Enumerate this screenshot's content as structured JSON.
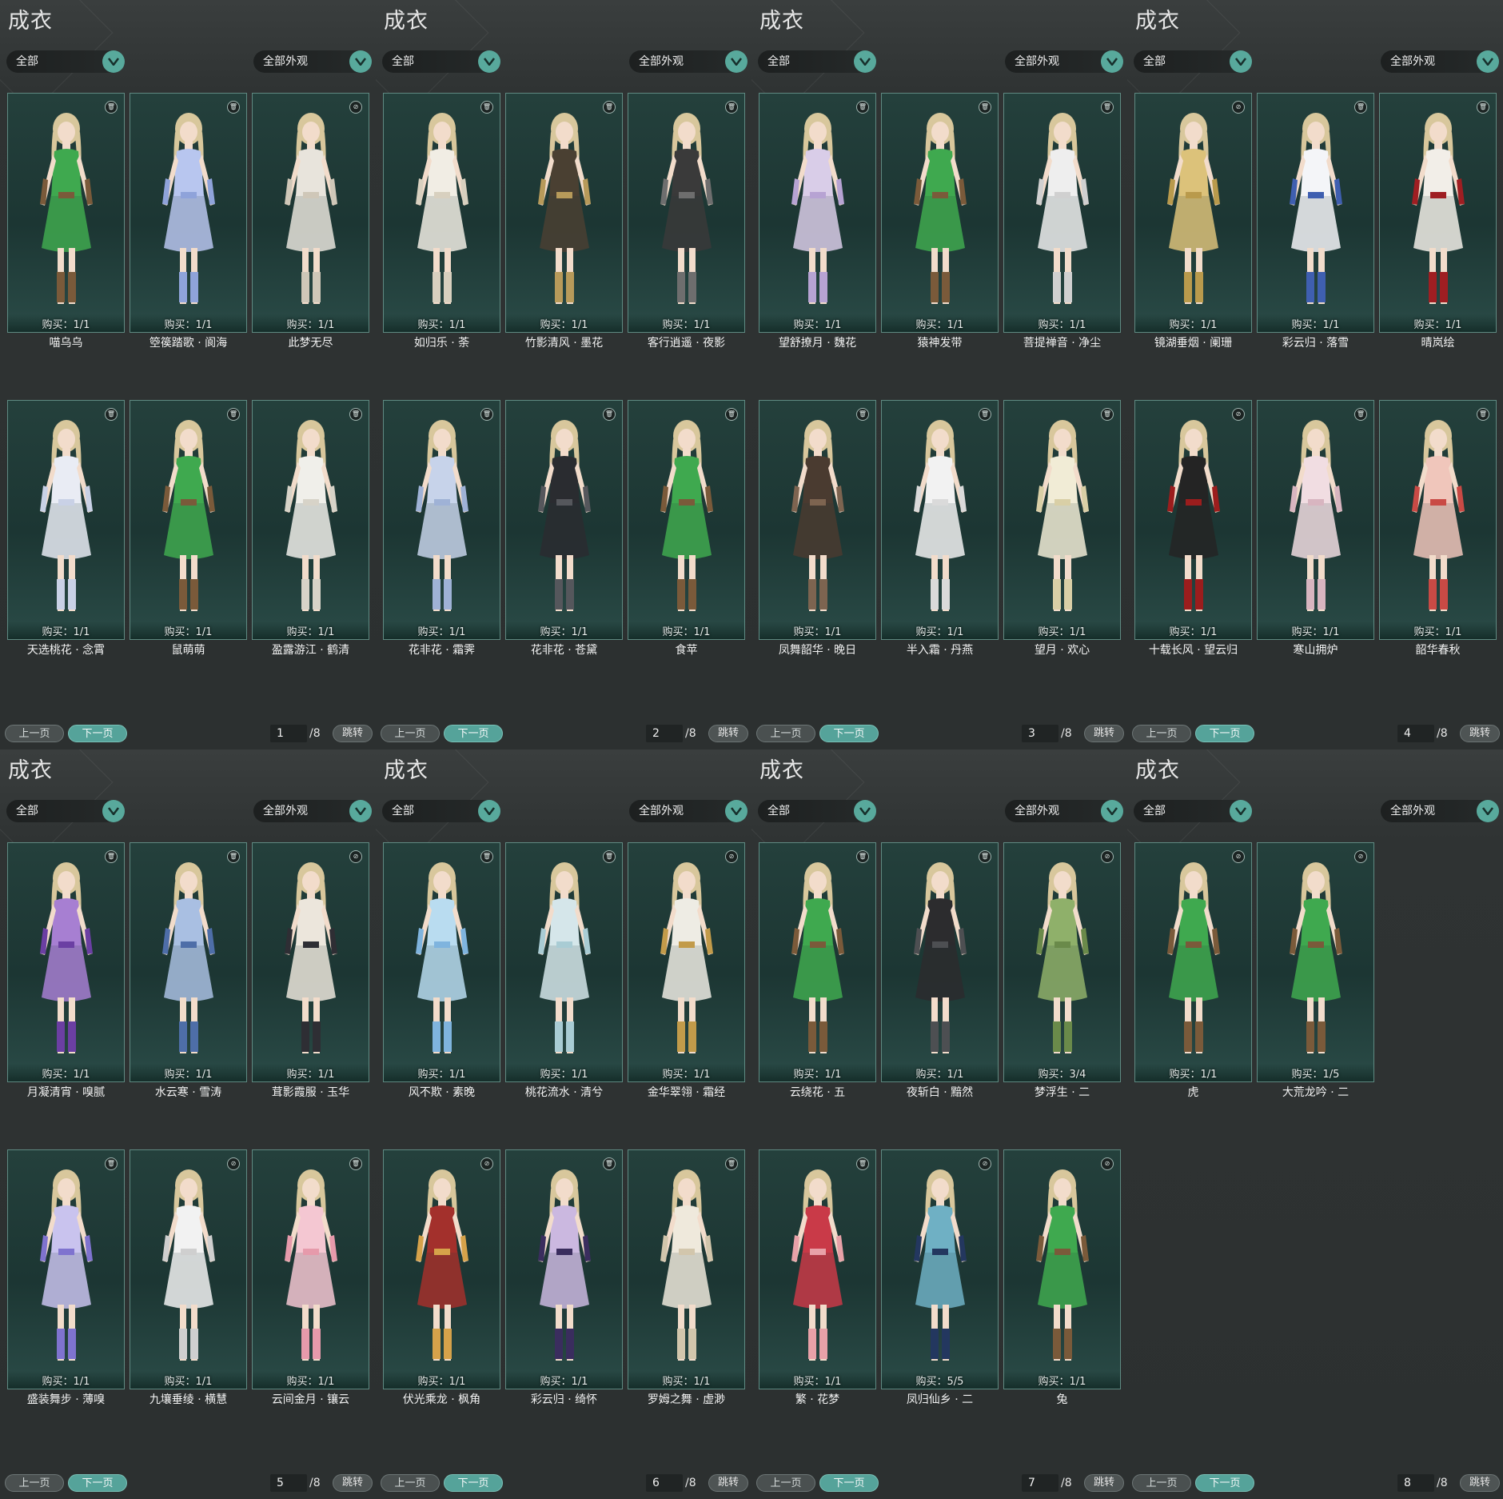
{
  "pages": [
    {
      "title": "成衣",
      "filter_all": "全部",
      "filter_appearance": "全部外观",
      "prev_label": "上一页",
      "next_label": "下一页",
      "page_no": "1",
      "page_total": "/8",
      "jump_label": "跳转",
      "items": [
        {
          "name": "喵乌乌",
          "buy": "购买：1/1",
          "badge": "trash-icon",
          "colors": [
            "#3fa94f",
            "#7a5a3a"
          ]
        },
        {
          "name": "箜篌踏歌 · 阆海",
          "buy": "购买：1/1",
          "badge": "trash-icon",
          "colors": [
            "#b8c6ef",
            "#8fa3da"
          ]
        },
        {
          "name": "此梦无尽",
          "buy": "购买：1/1",
          "badge": "hide-icon",
          "colors": [
            "#e8e4dc",
            "#cfc7b8"
          ]
        },
        {
          "name": "天选桃花 · 念霄",
          "buy": "购买：1/1",
          "badge": "trash-icon",
          "colors": [
            "#e9ecf4",
            "#c9d1e6"
          ]
        },
        {
          "name": "鼠萌萌",
          "buy": "购买：1/1",
          "badge": "trash-icon",
          "colors": [
            "#3fa94f",
            "#7a5a3a"
          ]
        },
        {
          "name": "盈露游江 · 鹤清",
          "buy": "购买：1/1",
          "badge": "trash-icon",
          "colors": [
            "#f0efea",
            "#d7d3c8"
          ]
        }
      ]
    },
    {
      "title": "成衣",
      "filter_all": "全部",
      "filter_appearance": "全部外观",
      "prev_label": "上一页",
      "next_label": "下一页",
      "page_no": "2",
      "page_total": "/8",
      "jump_label": "跳转",
      "items": [
        {
          "name": "如归乐 · 荼",
          "buy": "购买：1/1",
          "badge": "trash-icon",
          "colors": [
            "#f1ede4",
            "#d8d0bf"
          ]
        },
        {
          "name": "竹影清风 · 墨花",
          "buy": "购买：1/1",
          "badge": "trash-icon",
          "colors": [
            "#4a4032",
            "#b79a5a"
          ]
        },
        {
          "name": "客行逍遥 · 夜影",
          "buy": "购买：1/1",
          "badge": "trash-icon",
          "colors": [
            "#3a3a3a",
            "#6e6e6e"
          ]
        },
        {
          "name": "花非花 · 霜霁",
          "buy": "购买：1/1",
          "badge": "trash-icon",
          "colors": [
            "#c7d3ea",
            "#9fb2d6"
          ]
        },
        {
          "name": "花非花 · 苍黛",
          "buy": "购买：1/1",
          "badge": "trash-icon",
          "colors": [
            "#2a2c30",
            "#55575c"
          ]
        },
        {
          "name": "食苹",
          "buy": "购买：1/1",
          "badge": "trash-icon",
          "colors": [
            "#3fa94f",
            "#7a5a3a"
          ]
        }
      ]
    },
    {
      "title": "成衣",
      "filter_all": "全部",
      "filter_appearance": "全部外观",
      "prev_label": "上一页",
      "next_label": "下一页",
      "page_no": "3",
      "page_total": "/8",
      "jump_label": "跳转",
      "items": [
        {
          "name": "望舒撩月 · 魏花",
          "buy": "购买：1/1",
          "badge": "trash-icon",
          "colors": [
            "#d9cde8",
            "#b7a3d3"
          ]
        },
        {
          "name": "猿神发带",
          "buy": "购买：1/1",
          "badge": "trash-icon",
          "colors": [
            "#3fa94f",
            "#7a5a3a"
          ]
        },
        {
          "name": "菩提禅音 · 净尘",
          "buy": "购买：1/1",
          "badge": "trash-icon",
          "colors": [
            "#eeeeee",
            "#d0d0d0"
          ]
        },
        {
          "name": "凤舞韶华 · 晚日",
          "buy": "购买：1/1",
          "badge": "trash-icon",
          "colors": [
            "#4a3b30",
            "#7d6450"
          ]
        },
        {
          "name": "半入霜 · 丹燕",
          "buy": "购买：1/1",
          "badge": "trash-icon",
          "colors": [
            "#f2f2f2",
            "#dadada"
          ]
        },
        {
          "name": "望月 · 欢心",
          "buy": "购买：1/1",
          "badge": "trash-icon",
          "colors": [
            "#f1ecd6",
            "#d9cfa6"
          ]
        }
      ]
    },
    {
      "title": "成衣",
      "filter_all": "全部",
      "filter_appearance": "全部外观",
      "prev_label": "上一页",
      "next_label": "下一页",
      "page_no": "4",
      "page_total": "/8",
      "jump_label": "跳转",
      "items": [
        {
          "name": "镜湖垂烟 · 阑珊",
          "buy": "购买：1/1",
          "badge": "hide-icon",
          "colors": [
            "#dcc27a",
            "#b99a4c"
          ]
        },
        {
          "name": "彩云归 · 落雪",
          "buy": "购买：1/1",
          "badge": "trash-icon",
          "colors": [
            "#f4f5f8",
            "#3f5fb0"
          ]
        },
        {
          "name": "晴岚绘",
          "buy": "购买：1/1",
          "badge": "trash-icon",
          "colors": [
            "#f2eee8",
            "#9f1e22"
          ]
        },
        {
          "name": "十载长风 · 望云归",
          "buy": "购买：1/1",
          "badge": "hide-icon",
          "colors": [
            "#242424",
            "#9b1d1d"
          ]
        },
        {
          "name": "寒山拥炉",
          "buy": "购买：1/1",
          "badge": "trash-icon",
          "colors": [
            "#f1dde2",
            "#d8b5c0"
          ]
        },
        {
          "name": "韶华春秋",
          "buy": "购买：1/1",
          "badge": "trash-icon",
          "colors": [
            "#f0c6bb",
            "#c94a45"
          ]
        }
      ]
    },
    {
      "title": "成衣",
      "filter_all": "全部",
      "filter_appearance": "全部外观",
      "prev_label": "上一页",
      "next_label": "下一页",
      "page_no": "5",
      "page_total": "/8",
      "jump_label": "跳转",
      "items": [
        {
          "name": "月凝清宵 · 嗅腻",
          "buy": "购买：1/1",
          "badge": "trash-icon",
          "colors": [
            "#a77fd2",
            "#6b3fa3"
          ]
        },
        {
          "name": "水云寒 · 雪涛",
          "buy": "购买：1/1",
          "badge": "trash-icon",
          "colors": [
            "#a9bfe2",
            "#4e6ea8"
          ]
        },
        {
          "name": "茸影霞服 · 玉华",
          "buy": "购买：1/1",
          "badge": "hide-icon",
          "colors": [
            "#ece6dc",
            "#2e2e34"
          ]
        },
        {
          "name": "盛装舞步 · 薄嗅",
          "buy": "购买：1/1",
          "badge": "trash-icon",
          "colors": [
            "#c9c3ee",
            "#7f73cf"
          ]
        },
        {
          "name": "九壤垂绫 · 横慧",
          "buy": "购买：1/1",
          "badge": "hide-icon",
          "colors": [
            "#f2f2f2",
            "#cfcfcf"
          ]
        },
        {
          "name": "云间金月 · 镶云",
          "buy": "购买：1/1",
          "badge": "trash-icon",
          "colors": [
            "#f4c7d2",
            "#e69aab"
          ]
        }
      ]
    },
    {
      "title": "成衣",
      "filter_all": "全部",
      "filter_appearance": "全部外观",
      "prev_label": "上一页",
      "next_label": "下一页",
      "page_no": "6",
      "page_total": "/8",
      "jump_label": "跳转",
      "items": [
        {
          "name": "风不欺 · 素晚",
          "buy": "购买：1/1",
          "badge": "trash-icon",
          "colors": [
            "#b9dcf0",
            "#7fb4de"
          ]
        },
        {
          "name": "桃花流水 · 清兮",
          "buy": "购买：1/1",
          "badge": "trash-icon",
          "colors": [
            "#d5e6ea",
            "#a9ccd4"
          ]
        },
        {
          "name": "金华翠翎 · 霜经",
          "buy": "购买：1/1",
          "badge": "hide-icon",
          "colors": [
            "#eeece4",
            "#c29b4a"
          ]
        },
        {
          "name": "伏光乘龙 · 枫角",
          "buy": "购买：1/1",
          "badge": "hide-icon",
          "colors": [
            "#a3302c",
            "#d6a24a"
          ]
        },
        {
          "name": "彩云归 · 绮怀",
          "buy": "购买：1/1",
          "badge": "trash-icon",
          "colors": [
            "#cbb8e0",
            "#3a2d5e"
          ]
        },
        {
          "name": "罗姆之舞 · 虚渺",
          "buy": "购买：1/1",
          "badge": "trash-icon",
          "colors": [
            "#efe9dc",
            "#d2c6ac"
          ]
        }
      ]
    },
    {
      "title": "成衣",
      "filter_all": "全部",
      "filter_appearance": "全部外观",
      "prev_label": "上一页",
      "next_label": "下一页",
      "page_no": "7",
      "page_total": "/8",
      "jump_label": "跳转",
      "items": [
        {
          "name": "云绕花 · 五",
          "buy": "购买：1/1",
          "badge": "trash-icon",
          "colors": [
            "#3fa94f",
            "#7a5a3a"
          ]
        },
        {
          "name": "夜斩白 · 黯然",
          "buy": "购买：1/1",
          "badge": "trash-icon",
          "colors": [
            "#2c2c2e",
            "#4d4f52"
          ]
        },
        {
          "name": "梦浮生 · 二",
          "buy": "购买：3/4",
          "badge": "hide-icon",
          "colors": [
            "#8fb06a",
            "#6a8a4a"
          ]
        },
        {
          "name": "繁 · 花梦",
          "buy": "购买：1/1",
          "badge": "trash-icon",
          "colors": [
            "#c93a48",
            "#e8a1a8"
          ]
        },
        {
          "name": "凤归仙乡 · 二",
          "buy": "购买：5/5",
          "badge": "hide-icon",
          "colors": [
            "#6fb0c4",
            "#23375f"
          ]
        },
        {
          "name": "兔",
          "buy": "购买：1/1",
          "badge": "hide-icon",
          "colors": [
            "#3fa94f",
            "#7a5a3a"
          ]
        }
      ]
    },
    {
      "title": "成衣",
      "filter_all": "全部",
      "filter_appearance": "全部外观",
      "prev_label": "上一页",
      "next_label": "下一页",
      "page_no": "8",
      "page_total": "/8",
      "jump_label": "跳转",
      "items": [
        {
          "name": "虎",
          "buy": "购买：1/1",
          "badge": "hide-icon",
          "colors": [
            "#3fa94f",
            "#7a5a3a"
          ]
        },
        {
          "name": "大荒龙吟 · 二",
          "buy": "购买：1/5",
          "badge": "hide-icon",
          "colors": [
            "#3fa94f",
            "#7a5a3a"
          ]
        }
      ]
    }
  ]
}
